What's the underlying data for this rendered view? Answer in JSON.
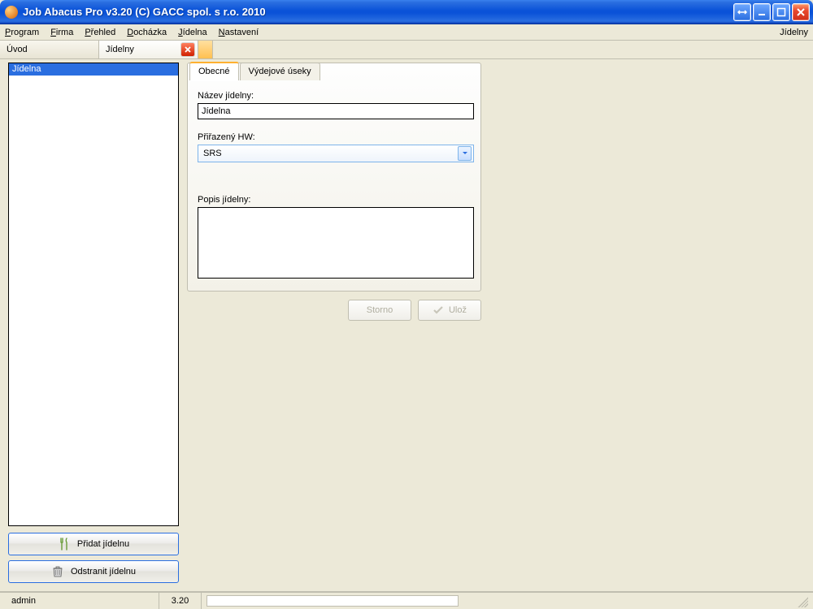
{
  "window": {
    "title": "Job Abacus Pro v3.20 (C) GACC spol. s r.o. 2010"
  },
  "menu": {
    "items": [
      "Program",
      "Firma",
      "Přehled",
      "Docházka",
      "Jídelna",
      "Nastavení"
    ],
    "right": "Jídelny"
  },
  "file_tabs": {
    "items": [
      {
        "label": "Úvod",
        "active": false,
        "closable": false
      },
      {
        "label": "Jídelny",
        "active": true,
        "closable": true
      }
    ]
  },
  "sidebar": {
    "list_items": [
      "Jídelna"
    ],
    "selected_index": 0,
    "add_label": "Přidat jídelnu",
    "remove_label": "Odstranit jídelnu"
  },
  "form": {
    "tabs": [
      "Obecné",
      "Výdejové úseky"
    ],
    "active_tab": 0,
    "name_label": "Název jídelny:",
    "name_value": "Jídelna",
    "hw_label": "Přiřazený HW:",
    "hw_value": "SRS",
    "desc_label": "Popis jídelny:",
    "desc_value": "",
    "cancel_label": "Storno",
    "save_label": "Ulož"
  },
  "status": {
    "user": "admin",
    "version": "3.20"
  }
}
